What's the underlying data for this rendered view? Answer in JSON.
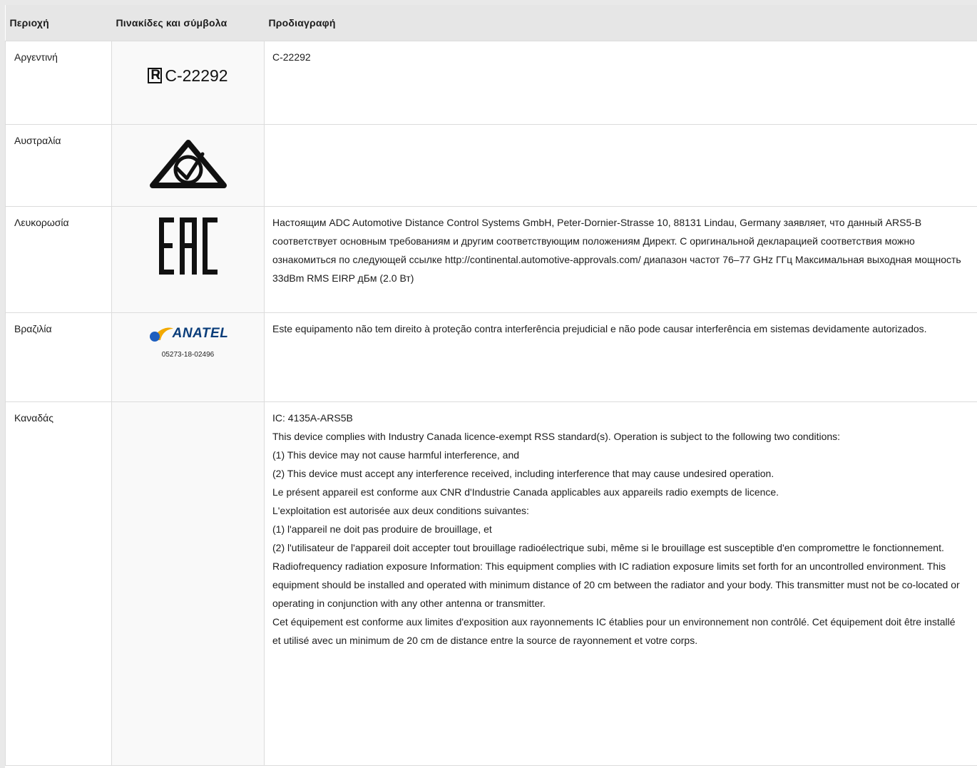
{
  "header": {
    "region": "Περιοχή",
    "symbols": "Πινακίδες και σύμβολα",
    "spec": "Προδιαγραφή"
  },
  "rows": [
    {
      "region": "Αργεντινή",
      "symbol_icon": "argentina-registration-mark",
      "symbol_text": "C-22292",
      "spec": [
        "C-22292"
      ]
    },
    {
      "region": "Αυστραλία",
      "symbol_icon": "rcm-compliance-mark",
      "spec": []
    },
    {
      "region": "Λευκορωσία",
      "symbol_icon": "eac-mark",
      "spec": [
        "Настоящим ADC Automotive Distance Control Systems GmbH, Peter-Dornier-Strasse 10, 88131 Lindau, Germany заявляет, что данный ARS5-B соответствует основным требованиям и другим соответствующим положениям Директ. С оригинальной декларацией соответствия можно ознакомиться по следующей ссылке http://continental.automotive-approvals.com/ диапазон частот 76–77 GHz ГГц Максимальная выходная мощность 33dBm RMS EIRP дБм (2.0 Вт)"
      ]
    },
    {
      "region": "Βραζιλία",
      "symbol_icon": "anatel-logo",
      "symbol_text": "ANATEL",
      "symbol_number": "05273-18-02496",
      "spec": [
        "Este equipamento não tem direito à proteção contra interferência prejudicial e não pode causar interferência em sistemas devidamente autorizados."
      ]
    },
    {
      "region": "Καναδάς",
      "spec": [
        "IC: 4135A-ARS5B",
        "This device complies with Industry Canada licence-exempt RSS standard(s). Operation is subject to the following two conditions:",
        "(1) This device may not cause harmful interference, and",
        "(2) This device must accept any interference received, including interference that may cause undesired operation.",
        "Le présent appareil est conforme aux CNR d'Industrie Canada applicables aux appareils radio exempts de licence.",
        "L'exploitation est autorisée aux deux conditions suivantes:",
        "(1) l'appareil ne doit pas produire de brouillage, et",
        "(2) l'utilisateur de l'appareil doit accepter tout brouillage radioélectrique subi, même si le brouillage est susceptible d'en compromettre le fonctionnement.",
        "Radiofrequency radiation exposure Information: This equipment complies with IC radiation exposure limits set forth for an uncontrolled environment. This equipment should be installed and operated with minimum distance of 20 cm between the radiator and your body. This transmitter must not be co-located or operating in conjunction with any other antenna or transmitter.",
        "Cet équipement est conforme aux limites d'exposition aux rayonnements IC établies pour un environnement non contrôlé. Cet équipement doit être installé et utilisé avec un minimum de 20 cm de distance entre la source de rayonnement et votre corps."
      ]
    }
  ]
}
